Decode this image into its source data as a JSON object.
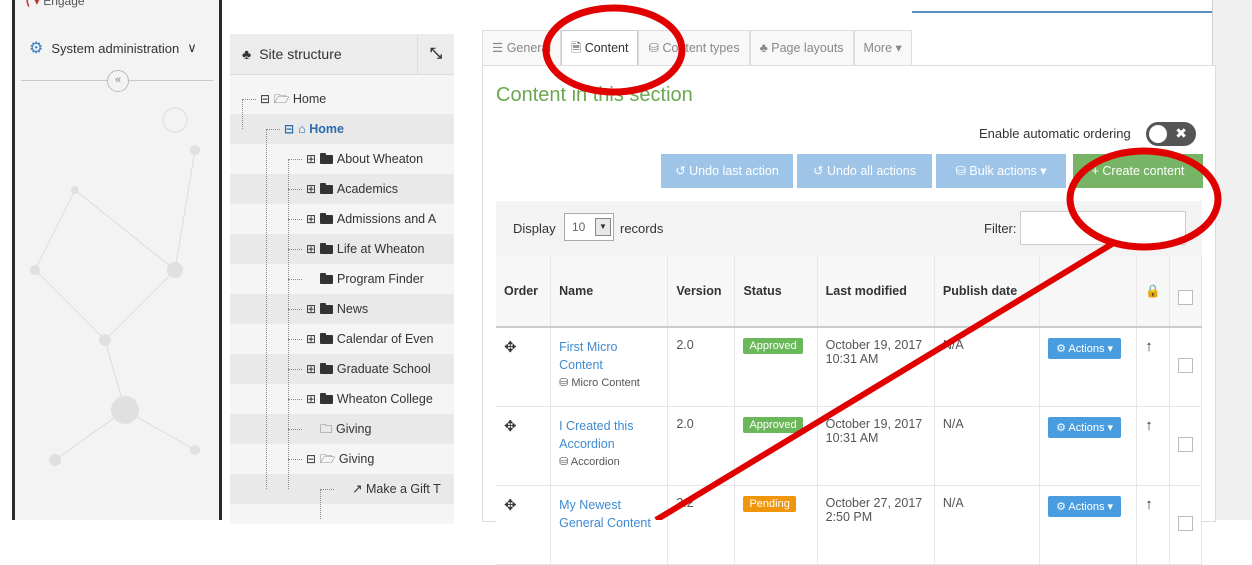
{
  "left_nav": {
    "top_item": "Engage",
    "sysadmin_label": "System administration",
    "chevron": "∨",
    "collapse_icon": "«"
  },
  "site_structure": {
    "title": "Site structure",
    "expand_icon": "⤡",
    "tree": [
      {
        "label": "Home",
        "icon": "folder-open-icon",
        "expander": "minus"
      },
      {
        "label": "Home",
        "icon": "home-icon",
        "expander": "minus",
        "bold": true
      },
      {
        "label": "About Wheaton",
        "icon": "folder-icon",
        "expander": "plus"
      },
      {
        "label": "Academics",
        "icon": "folder-icon",
        "expander": "plus"
      },
      {
        "label": "Admissions and A",
        "icon": "folder-icon",
        "expander": "plus"
      },
      {
        "label": "Life at Wheaton",
        "icon": "folder-icon",
        "expander": "plus"
      },
      {
        "label": "Program Finder",
        "icon": "folder-icon",
        "expander": "none"
      },
      {
        "label": "News",
        "icon": "folder-icon",
        "expander": "plus"
      },
      {
        "label": "Calendar of Even",
        "icon": "folder-icon",
        "expander": "plus"
      },
      {
        "label": "Graduate School",
        "icon": "folder-icon",
        "expander": "plus"
      },
      {
        "label": "Wheaton College",
        "icon": "folder-icon",
        "expander": "plus"
      },
      {
        "label": "Giving",
        "icon": "folder-outline-icon",
        "expander": "none"
      },
      {
        "label": "Giving",
        "icon": "folder-open-icon",
        "expander": "minus"
      },
      {
        "label": "Make a Gift T",
        "icon": "external-link-icon",
        "expander": "none"
      }
    ]
  },
  "tabs": [
    {
      "label": "General",
      "icon": "sliders-icon",
      "active": false
    },
    {
      "label": "Content",
      "icon": "document-icon",
      "active": true
    },
    {
      "label": "Content types",
      "icon": "cubes-icon",
      "active": false
    },
    {
      "label": "Page layouts",
      "icon": "sitemap-icon",
      "active": false
    },
    {
      "label": "More ▾",
      "icon": "",
      "active": false
    }
  ],
  "section_title": "Content in this section",
  "auto_ordering_label": "Enable automatic ordering",
  "toolbar": {
    "undo_last": "Undo last action",
    "undo_all": "Undo all actions",
    "bulk": "Bulk actions",
    "create": "Create content"
  },
  "grid": {
    "display_label": "Display",
    "records_value": "10",
    "records_label": "records",
    "filter_label": "Filter:"
  },
  "table": {
    "columns": [
      "Order",
      "Name",
      "Version",
      "Status",
      "Last modified",
      "Publish date",
      "",
      ""
    ],
    "rows": [
      {
        "name": "First Micro Content",
        "type": "Micro Content",
        "version": "2.0",
        "status": "Approved",
        "status_color": "#6bb85a",
        "modified": "October 19, 2017 10:31 AM",
        "publish": "N/A",
        "actions": "Actions"
      },
      {
        "name": "I Created this Accordion",
        "type": "Accordion",
        "version": "2.0",
        "status": "Approved",
        "status_color": "#6bb85a",
        "modified": "October 19, 2017 10:31 AM",
        "publish": "N/A",
        "actions": "Actions"
      },
      {
        "name": "My Newest General Content",
        "type": "",
        "version": "3.2",
        "status": "Pending",
        "status_color": "#f0960a",
        "modified": "October 27, 2017 2:50 PM",
        "publish": "N/A",
        "actions": "Actions"
      }
    ]
  },
  "annotation_color": "#e00000"
}
